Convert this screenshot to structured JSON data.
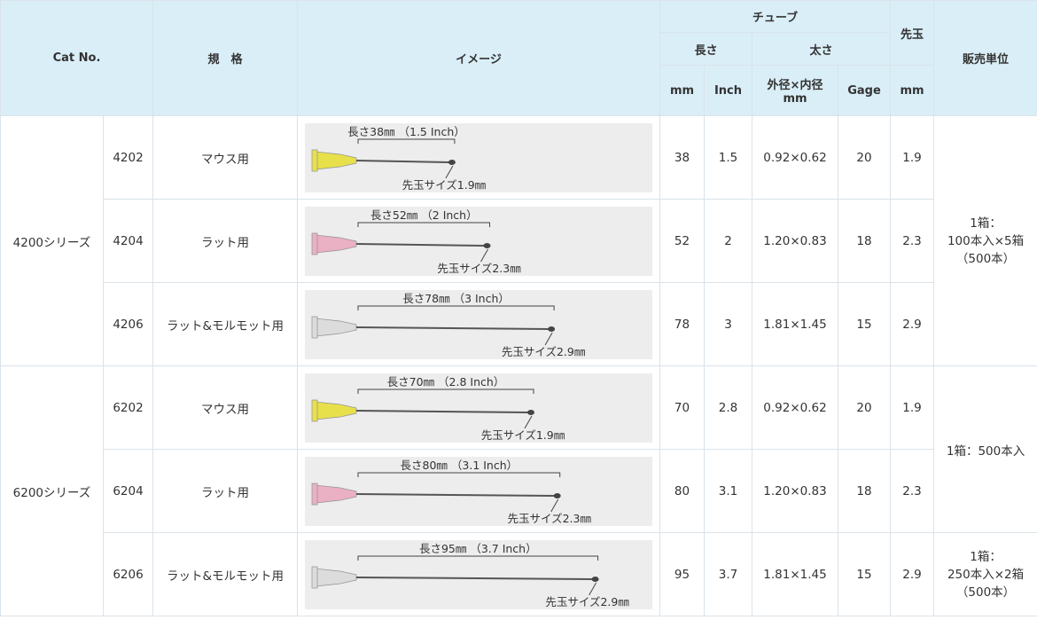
{
  "header": {
    "cat_no": "Cat No.",
    "spec": "規　格",
    "image": "イメージ",
    "tube": "チューブ",
    "length": "長さ",
    "thickness": "太さ",
    "tip": "先玉",
    "sales_unit": "販売単位",
    "mm": "mm",
    "inch": "Inch",
    "od_id_line1": "外径×内径",
    "od_id_line2": "mm",
    "gage": "Gage",
    "tip_mm": "mm"
  },
  "series": [
    {
      "name": "4200シリーズ"
    },
    {
      "name": "6200シリーズ"
    }
  ],
  "rows": [
    {
      "cat": "4202",
      "spec": "マウス用",
      "len_label": "長さ38㎜ （1.5 Inch）",
      "tip_label": "先玉サイズ1.9㎜",
      "hub_color": "#e8e04a",
      "len_frac": 0.33,
      "mm": "38",
      "inch": "1.5",
      "od_id": "0.92×0.62",
      "gage": "20",
      "tip": "1.9"
    },
    {
      "cat": "4204",
      "spec": "ラット用",
      "len_label": "長さ52㎜ （2 Inch）",
      "tip_label": "先玉サイズ2.3㎜",
      "hub_color": "#eab0c4",
      "len_frac": 0.45,
      "mm": "52",
      "inch": "2",
      "od_id": "1.20×0.83",
      "gage": "18",
      "tip": "2.3"
    },
    {
      "cat": "4206",
      "spec": "ラット&モルモット用",
      "len_label": "長さ78㎜ （3 Inch）",
      "tip_label": "先玉サイズ2.9㎜",
      "hub_color": "#dcdcdc",
      "len_frac": 0.67,
      "mm": "78",
      "inch": "3",
      "od_id": "1.81×1.45",
      "gage": "15",
      "tip": "2.9"
    },
    {
      "cat": "6202",
      "spec": "マウス用",
      "len_label": "長さ70㎜ （2.8 Inch）",
      "tip_label": "先玉サイズ1.9㎜",
      "hub_color": "#e8e04a",
      "len_frac": 0.6,
      "mm": "70",
      "inch": "2.8",
      "od_id": "0.92×0.62",
      "gage": "20",
      "tip": "1.9"
    },
    {
      "cat": "6204",
      "spec": "ラット用",
      "len_label": "長さ80㎜ （3.1 Inch）",
      "tip_label": "先玉サイズ2.3㎜",
      "hub_color": "#eab0c4",
      "len_frac": 0.69,
      "mm": "80",
      "inch": "3.1",
      "od_id": "1.20×0.83",
      "gage": "18",
      "tip": "2.3"
    },
    {
      "cat": "6206",
      "spec": "ラット&モルモット用",
      "len_label": "長さ95㎜ （3.7 Inch）",
      "tip_label": "先玉サイズ2.9㎜",
      "hub_color": "#dcdcdc",
      "len_frac": 0.82,
      "mm": "95",
      "inch": "3.7",
      "od_id": "1.81×1.45",
      "gage": "15",
      "tip": "2.9"
    }
  ],
  "sales_units": {
    "g4200": [
      "1箱：",
      "100本入×5箱",
      "（500本）"
    ],
    "g6200a": "1箱：500本入",
    "g6206": [
      "1箱：",
      "250本入×2箱",
      "（500本）"
    ]
  }
}
